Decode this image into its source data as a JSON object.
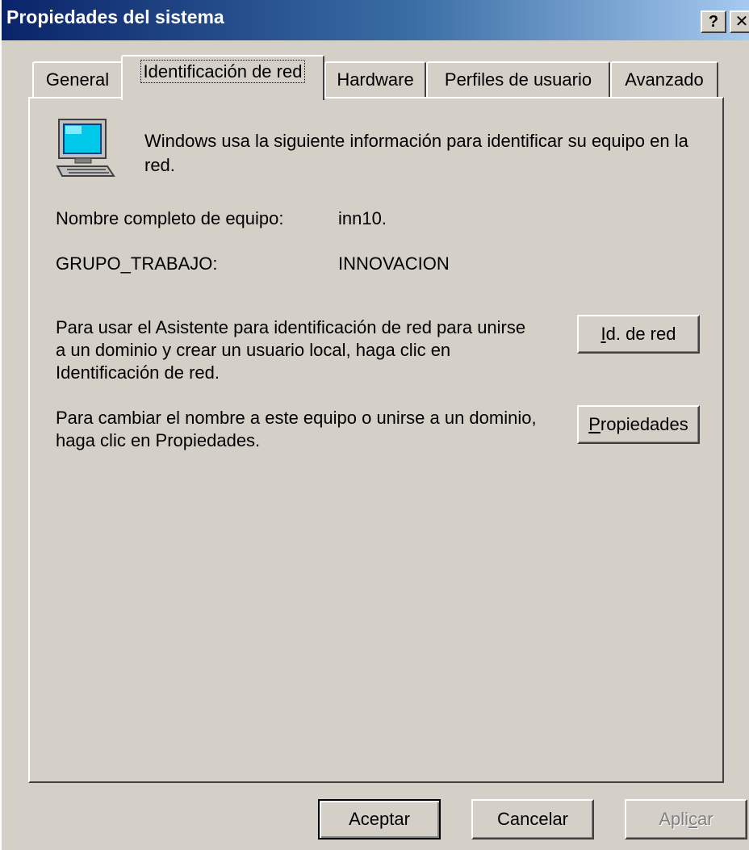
{
  "window": {
    "title": "Propiedades del sistema",
    "help_label": "?",
    "close_label": "✕"
  },
  "tabs": [
    {
      "label": "General",
      "active": false
    },
    {
      "label": "Identificación de red",
      "active": true
    },
    {
      "label": "Hardware",
      "active": false
    },
    {
      "label": "Perfiles de usuario",
      "active": false
    },
    {
      "label": "Avanzado",
      "active": false
    }
  ],
  "panel": {
    "icon": "computer-icon",
    "intro": "Windows usa la siguiente información para identificar su equipo en la red.",
    "full_name_label": "Nombre completo de equipo:",
    "full_name_value": "inn10.",
    "workgroup_label": "GRUPO_TRABAJO:",
    "workgroup_value": "INNOVACION",
    "wizard_text": "Para usar el Asistente para identificación de red para unirse a un dominio y crear un usuario local, haga clic en Identificación de red.",
    "id_button": {
      "mnemonic": "I",
      "rest": "d. de red"
    },
    "rename_text": "Para cambiar el nombre a este equipo o unirse a un dominio, haga clic en Propiedades.",
    "properties_button": {
      "mnemonic": "P",
      "rest": "ropiedades"
    }
  },
  "footer": {
    "ok_label": "Aceptar",
    "cancel_label": "Cancelar",
    "apply": {
      "before": "Apli",
      "mnemonic": "c",
      "after": "ar",
      "enabled": false
    }
  },
  "colors": {
    "face": "#d4d0c8",
    "title_start": "#0a246a",
    "title_end": "#a6caf0",
    "disabled_text": "#808080"
  }
}
